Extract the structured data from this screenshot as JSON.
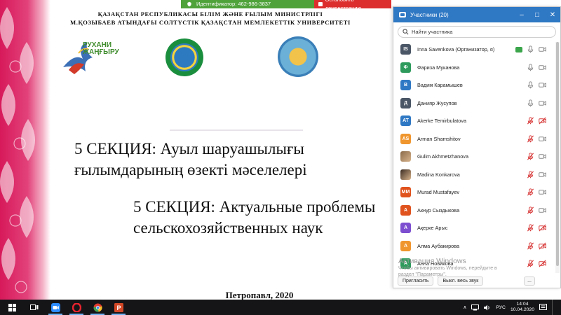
{
  "slide": {
    "header_line1": "ҚАЗАҚСТАН РЕСПУБЛИКАСЫ БІЛІМ ЖӘНЕ ҒЫЛЫМ МИНИСТРЛІГІ",
    "header_line2": "М.ҚОЗЫБАЕВ АТЫНДАҒЫ СОЛТҮСТІК ҚАЗАҚСТАН МЕМЛЕКЕТТІК УНИВЕРСИТЕТІ",
    "logo_rukhani_line1": "РУХАНИ",
    "logo_rukhani_line2": "ЖАҢҒЫРУ",
    "section_kz_line1": "5 СЕКЦИЯ: Ауыл шаруашылығы",
    "section_kz_line2": "ғылымдарының өзекті мәселелері",
    "section_ru_line1": "5 СЕКЦИЯ: Актуальные проблемы",
    "section_ru_line2": "сельскохозяйственных наук",
    "city_year": "Петропавл, 2020"
  },
  "share_bar": {
    "meeting_id": "Идентификатор: 462-986-3837",
    "stop_label": "Остановить демонстрацию"
  },
  "participants_panel": {
    "title": "Участники (20)",
    "search_placeholder": "Найти участника",
    "participants": [
      {
        "initials": "IS",
        "name": "Inna Savenkova (Организатор, я)",
        "color": "#4a5565",
        "sharing": true,
        "mic_muted": false,
        "video_off": false
      },
      {
        "initials": "Ф",
        "name": "Фариза Муканова",
        "color": "#2e9b5c",
        "sharing": false,
        "mic_muted": false,
        "video_off": false
      },
      {
        "initials": "В",
        "name": "Вадим Карамышев",
        "color": "#2f78c4",
        "sharing": false,
        "mic_muted": false,
        "video_off": false
      },
      {
        "initials": "Д",
        "name": "Данияр Жусупов",
        "color": "#4a5565",
        "sharing": false,
        "mic_muted": false,
        "video_off": false
      },
      {
        "initials": "AT",
        "name": "Akerke Temirbulatova",
        "color": "#2f78c4",
        "sharing": false,
        "mic_muted": true,
        "video_off": true
      },
      {
        "initials": "AS",
        "name": "Arman Shamshitov",
        "color": "#f0962e",
        "sharing": false,
        "mic_muted": true,
        "video_off": false
      },
      {
        "initials": "",
        "name": "Gulim Akhmetzhanova",
        "color": "#8a6a4a",
        "sharing": false,
        "mic_muted": true,
        "video_off": false
      },
      {
        "initials": "",
        "name": "Madina Konkarova",
        "color": "#3a2a22",
        "sharing": false,
        "mic_muted": true,
        "video_off": false
      },
      {
        "initials": "MM",
        "name": "Murad Mustafayev",
        "color": "#e0531e",
        "sharing": false,
        "mic_muted": true,
        "video_off": false
      },
      {
        "initials": "А",
        "name": "Акнур Сыздыкова",
        "color": "#e0531e",
        "sharing": false,
        "mic_muted": true,
        "video_off": false
      },
      {
        "initials": "А",
        "name": "Ақерке Арыс",
        "color": "#7d4fd0",
        "sharing": false,
        "mic_muted": true,
        "video_off": true
      },
      {
        "initials": "А",
        "name": "Алма Аубакирова",
        "color": "#f0962e",
        "sharing": false,
        "mic_muted": true,
        "video_off": true
      },
      {
        "initials": "А",
        "name": "Анна Новикова",
        "color": "#2e9b5c",
        "sharing": false,
        "mic_muted": true,
        "video_off": true
      }
    ],
    "invite_label": "Пригласить",
    "mute_all_label": "Выкл. весь звук",
    "more_label": "..."
  },
  "watermark": {
    "line1": "Активация Windows",
    "line2": "Чтобы активировать Windows, перейдите в",
    "line3": "раздел \"Параметры\"."
  },
  "taskbar": {
    "language": "РУС",
    "time": "14:04",
    "date": "10.04.2020"
  }
}
